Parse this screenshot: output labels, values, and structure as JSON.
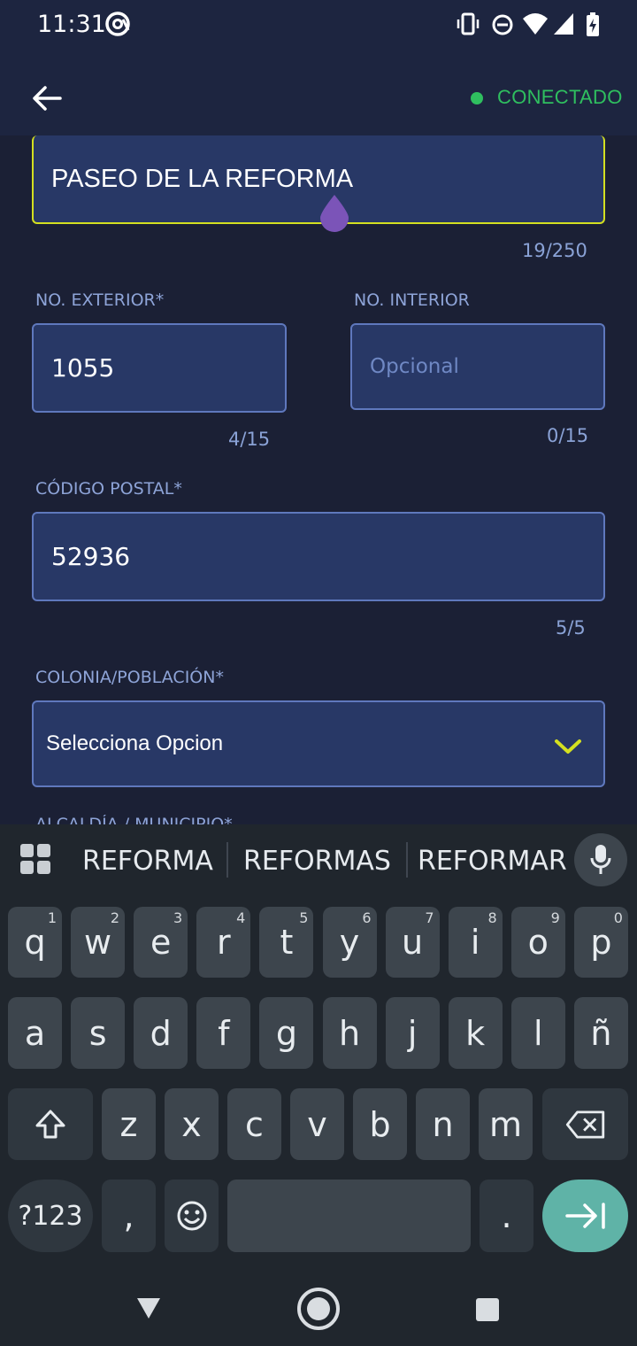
{
  "status_bar": {
    "time": "11:31"
  },
  "header": {
    "back_icon": "arrow-left-icon",
    "connection_status": "CONECTADO",
    "status_color": "#2fbf5f"
  },
  "form": {
    "street": {
      "value": "PASEO DE LA REFORMA",
      "counter": "19/250"
    },
    "exterior": {
      "label": "NO. EXTERIOR*",
      "value": "1055",
      "counter": "4/15"
    },
    "interior": {
      "label": "NO. INTERIOR",
      "placeholder": "Opcional",
      "counter": "0/15"
    },
    "postal": {
      "label": "CÓDIGO POSTAL*",
      "value": "52936",
      "counter": "5/5"
    },
    "colonia": {
      "label": "COLONIA/POBLACIÓN*",
      "selected": "Selecciona Opcion"
    },
    "municipio": {
      "label": "ALCALDÍA / MUNICIPIO*"
    }
  },
  "keyboard": {
    "suggestions": [
      "REFORMA",
      "REFORMAS",
      "REFORMAR"
    ],
    "row1": [
      [
        "q",
        "1"
      ],
      [
        "w",
        "2"
      ],
      [
        "e",
        "3"
      ],
      [
        "r",
        "4"
      ],
      [
        "t",
        "5"
      ],
      [
        "y",
        "6"
      ],
      [
        "u",
        "7"
      ],
      [
        "i",
        "8"
      ],
      [
        "o",
        "9"
      ],
      [
        "p",
        "0"
      ]
    ],
    "row2": [
      "a",
      "s",
      "d",
      "f",
      "g",
      "h",
      "j",
      "k",
      "l",
      "ñ"
    ],
    "row3": [
      "z",
      "x",
      "c",
      "v",
      "b",
      "n",
      "m"
    ],
    "numbers_key": "?123",
    "comma": ",",
    "period": ".",
    "accent": "#5fb3a7"
  }
}
